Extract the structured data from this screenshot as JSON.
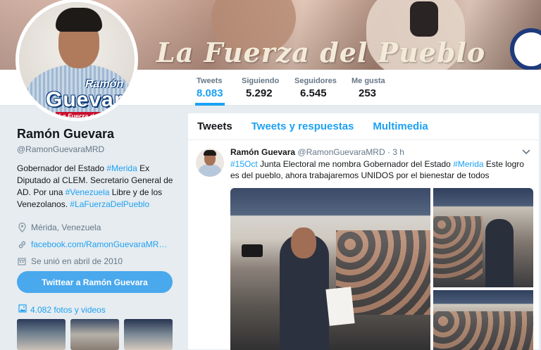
{
  "banner": {
    "slogan": "La Fuerza del Pueblo"
  },
  "avatar": {
    "name_small": "Ramón",
    "name_large": "Guevara",
    "tagline": "La Fuerza del P"
  },
  "stats": [
    {
      "label": "Tweets",
      "value": "8.083",
      "active": true
    },
    {
      "label": "Siguiendo",
      "value": "5.292",
      "active": false
    },
    {
      "label": "Seguidores",
      "value": "6.545",
      "active": false
    },
    {
      "label": "Me gusta",
      "value": "253",
      "active": false
    }
  ],
  "profile": {
    "name": "Ramón Guevara",
    "handle": "@RamonGuevaraMRD",
    "bio_1": "Gobernador del Estado ",
    "bio_ht1": "#Merida",
    "bio_2": " Ex Diputado al CLEM. Secretario General de AD. Por una ",
    "bio_ht2": "#Venezuela",
    "bio_3": " Libre y de los Venezolanos. ",
    "bio_ht3": "#LaFuerzaDelPueblo",
    "location": "Mérida, Venezuela",
    "website": "facebook.com/RamonGuevaraMR…",
    "joined": "Se unió en abril de 2010",
    "tweet_to_button": "Twittear a Ramón Guevara",
    "photos_link": "4.082 fotos y videos"
  },
  "timeline": {
    "tabs": [
      "Tweets",
      "Tweets y respuestas",
      "Multimedia"
    ],
    "tweet": {
      "name": "Ramón Guevara",
      "handle": "@RamonGuevaraMRD",
      "sep": "·",
      "time": "3 h",
      "ht1": "#15Oct",
      "text_1": " Junta Electoral me nombra Gobernador del Estado ",
      "ht2": "#Merida",
      "text_2": " Este logro es del pueblo, ahora trabajaremos UNIDOS por el bienestar de todos"
    }
  },
  "colors": {
    "accent": "#1da1f2",
    "button": "#4aa8ed",
    "page_bg": "#e6ecf0"
  },
  "icons": [
    "location-icon",
    "link-icon",
    "calendar-icon",
    "photos-icon",
    "chevron-down-icon"
  ]
}
